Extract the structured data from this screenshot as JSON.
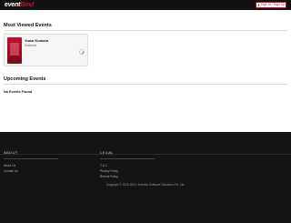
{
  "header": {
    "logo_main": "event",
    "logo_accent": "Bind",
    "signin_label": "Sign In / Sign Up"
  },
  "most_viewed": {
    "title": "Most Viewed Events",
    "events": [
      {
        "title": "Yuwa Kumara",
        "location": "Chennai"
      }
    ]
  },
  "upcoming": {
    "title": "Upcoming Events",
    "empty_message": "No Events Found"
  },
  "footer": {
    "about": {
      "heading": "ABOUT",
      "links": [
        "About Us",
        "Contact Us"
      ]
    },
    "legal": {
      "heading": "LEGAL",
      "links": [
        "T & C",
        "Privacy Policy",
        "Refund Policy"
      ]
    },
    "copyright": "Copyright © 2019-2024. Eventus Software Solutions Pvt. Ltd."
  },
  "colors": {
    "brand": "#c4122f",
    "topbar_bg": "#111111",
    "footer_bg": "#141414"
  }
}
